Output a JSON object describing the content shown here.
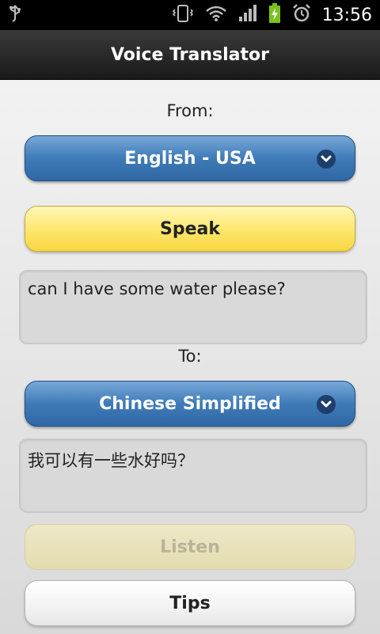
{
  "status_bar": {
    "time": "13:56",
    "icons": [
      "usb-icon",
      "vibrate-icon",
      "wifi-icon",
      "signal-icon",
      "battery-charging-icon",
      "alarm-icon"
    ]
  },
  "app": {
    "title": "Voice Translator"
  },
  "from": {
    "label": "From:",
    "language": "English - USA",
    "speak_button": "Speak",
    "text": "can I have some water please?"
  },
  "to": {
    "label": "To:",
    "language": "Chinese Simplified",
    "text": "我可以有一些水好吗？"
  },
  "buttons": {
    "listen": "Listen",
    "tips": "Tips"
  },
  "colors": {
    "accent_blue": "#3f7bb8",
    "speak_yellow": "#ffe871",
    "title_bg": "#1a1a1a"
  }
}
